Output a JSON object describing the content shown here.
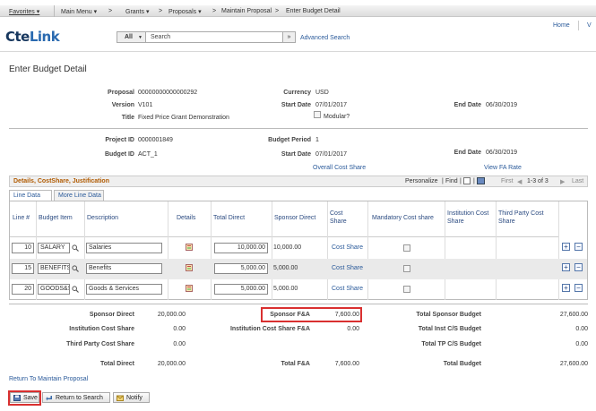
{
  "nav": {
    "favorites": "Favorites",
    "main_menu": "Main Menu",
    "grants": "Grants",
    "proposals": "Proposals",
    "maintain_proposal": "Maintain Proposal",
    "current": "Enter Budget Detail"
  },
  "header": {
    "logo_a": "Cte",
    "logo_b": "Link",
    "search_scope": "All",
    "search_placeholder": "Search",
    "search_go": "»",
    "advanced_search": "Advanced Search",
    "home": "Home",
    "v": "V"
  },
  "page_title": "Enter Budget Detail",
  "proposal": {
    "proposal_label": "Proposal",
    "proposal_value": "00000000000000292",
    "version_label": "Version",
    "version_value": "V101",
    "title_label": "Title",
    "title_value": "Fixed Price Grant Demonstration",
    "currency_label": "Currency",
    "currency_value": "USD",
    "start_label": "Start Date",
    "start_value": "07/01/2017",
    "end_label": "End Date",
    "end_value": "06/30/2019",
    "modular_label": "Modular?"
  },
  "project": {
    "project_label": "Project ID",
    "project_value": "0000001849",
    "budget_label": "Budget ID",
    "budget_value": "ACT_1",
    "period_label": "Budget Period",
    "period_value": "1",
    "start_label": "Start Date",
    "start_value": "07/01/2017",
    "end_label": "End Date",
    "end_value": "06/30/2019",
    "overall_cost_share": "Overall Cost Share",
    "view_fa_rate": "View FA Rate"
  },
  "grid": {
    "title": "Details, CostShare, Justification",
    "personalize": "Personalize",
    "find": "Find",
    "first": "First",
    "range": "1-3 of 3",
    "last": "Last",
    "tabs": [
      "Line Data",
      "More Line Data"
    ],
    "columns": [
      "Line #",
      "Budget Item",
      "Description",
      "Details",
      "Total Direct",
      "Sponsor Direct",
      "Cost Share",
      "Mandatory Cost share",
      "Institution Cost Share",
      "Third Party Cost Share"
    ],
    "rows": [
      {
        "line": "10",
        "item": "SALARY",
        "desc": "Salaries",
        "total": "10,000.00",
        "sponsor": "10,000.00",
        "cost_share": "Cost Share"
      },
      {
        "line": "15",
        "item": "BENEFITS",
        "desc": "Benefits",
        "total": "5,000.00",
        "sponsor": "5,000.00",
        "cost_share": "Cost Share"
      },
      {
        "line": "20",
        "item": "GOODS&S",
        "desc": "Goods & Services",
        "total": "5,000.00",
        "sponsor": "5,000.00",
        "cost_share": "Cost Share"
      }
    ]
  },
  "totals": {
    "sponsor_direct_label": "Sponsor Direct",
    "sponsor_direct_value": "20,000.00",
    "sponsor_fa_label": "Sponsor F&A",
    "sponsor_fa_value": "7,600.00",
    "total_sponsor_budget_label": "Total Sponsor Budget",
    "total_sponsor_budget_value": "27,600.00",
    "inst_cs_label": "Institution Cost Share",
    "inst_cs_value": "0.00",
    "inst_cs_fa_label": "Institution Cost Share F&A",
    "inst_cs_fa_value": "0.00",
    "total_inst_label": "Total Inst C/S Budget",
    "total_inst_value": "0.00",
    "third_party_label": "Third Party Cost Share",
    "third_party_value": "0.00",
    "total_tp_label": "Total TP C/S Budget",
    "total_tp_value": "0.00",
    "total_direct_label": "Total Direct",
    "total_direct_value": "20,000.00",
    "total_fa_label": "Total F&A",
    "total_fa_value": "7,600.00",
    "total_budget_label": "Total Budget",
    "total_budget_value": "27,600.00"
  },
  "footer": {
    "return_link": "Return To Maintain Proposal",
    "save": "Save",
    "return_search": "Return to Search",
    "notify": "Notify"
  },
  "colors": {
    "highlight": "#d93030",
    "link": "#2a5a9a",
    "grid_title": "#b05a00"
  }
}
